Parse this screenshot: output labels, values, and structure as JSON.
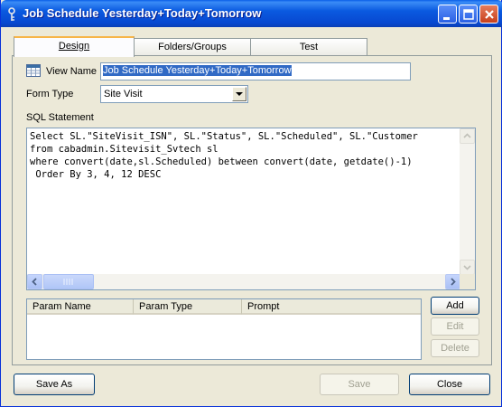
{
  "window": {
    "title": "Job Schedule Yesterday+Today+Tomorrow"
  },
  "tabs": [
    {
      "label": "Design",
      "active": true
    },
    {
      "label": "Folders/Groups",
      "active": false
    },
    {
      "label": "Test",
      "active": false
    }
  ],
  "form": {
    "view_name_label": "View Name",
    "view_name_value": "Job Schedule Yesterday+Today+Tomorrow",
    "form_type_label": "Form Type",
    "form_type_value": "Site Visit",
    "sql_label": "SQL Statement",
    "sql_lines": [
      "Select SL.\"SiteVisit_ISN\", SL.\"Status\", SL.\"Scheduled\", SL.\"Customer",
      "from cabadmin.Sitevisit_Svtech sl",
      "where convert(date,sl.Scheduled) between convert(date, getdate()-1)",
      " Order By 3, 4, 12 DESC"
    ]
  },
  "params": {
    "columns": [
      "Param Name",
      "Param Type",
      "Prompt"
    ],
    "rows": [],
    "add_label": "Add",
    "edit_label": "Edit",
    "delete_label": "Delete"
  },
  "footer": {
    "save_as_label": "Save As",
    "save_label": "Save",
    "close_label": "Close"
  },
  "icons": {
    "app": "key-icon",
    "view_name": "table-icon"
  },
  "colors": {
    "titlebar": "#0a5ae0",
    "selection": "#316ac5",
    "tab_highlight": "#f7b548"
  }
}
